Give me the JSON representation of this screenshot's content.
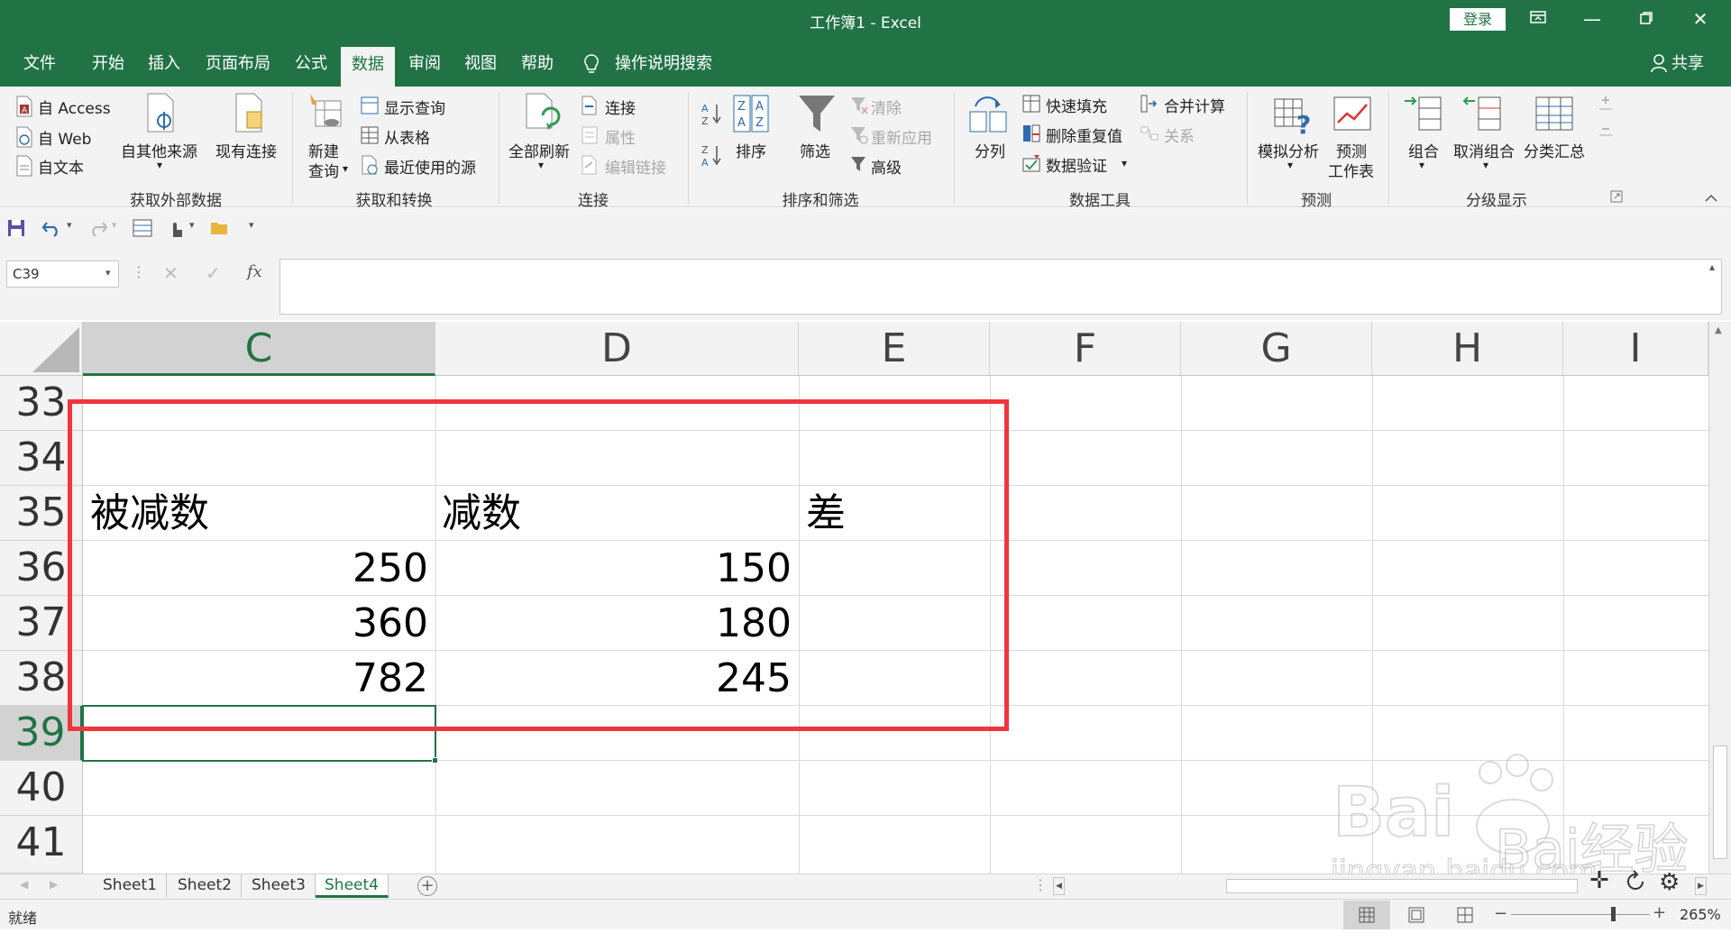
{
  "window": {
    "title": "工作簿1  -  Excel",
    "login": "登录"
  },
  "tabs": [
    "文件",
    "开始",
    "插入",
    "页面布局",
    "公式",
    "数据",
    "审阅",
    "视图",
    "帮助"
  ],
  "active_tab": "数据",
  "tell_me": "操作说明搜索",
  "share": "共享",
  "ribbon": {
    "get_external": {
      "access": "自 Access",
      "web": "自 Web",
      "text": "自文本",
      "other": "自其他来源",
      "existing": "现有连接",
      "label": "获取外部数据"
    },
    "get_transform": {
      "new_query": "新建\n查询",
      "new_query_line1": "新建",
      "new_query_line2": "查询",
      "show_queries": "显示查询",
      "from_table": "从表格",
      "recent_sources": "最近使用的源",
      "label": "获取和转换"
    },
    "connections": {
      "refresh_all": "全部刷新",
      "connections": "连接",
      "properties": "属性",
      "edit_links": "编辑链接",
      "label": "连接"
    },
    "sort_filter": {
      "sort": "排序",
      "filter": "筛选",
      "clear": "清除",
      "reapply": "重新应用",
      "advanced": "高级",
      "label": "排序和筛选"
    },
    "data_tools": {
      "split": "分列",
      "flash_fill": "快速填充",
      "remove_dup": "删除重复值",
      "validation": "数据验证",
      "consolidate": "合并计算",
      "relations": "关系",
      "label": "数据工具"
    },
    "forecast": {
      "what_if": "模拟分析",
      "forecast_sheet_1": "预测",
      "forecast_sheet_2": "工作表",
      "label": "预测"
    },
    "outline": {
      "group": "组合",
      "ungroup": "取消组合",
      "subtotal": "分类汇总",
      "label": "分级显示"
    }
  },
  "name_box": "C39",
  "fx": "fx",
  "columns": [
    "C",
    "D",
    "E",
    "F",
    "G",
    "H",
    "I"
  ],
  "selected_column": "C",
  "rows": [
    "33",
    "34",
    "35",
    "36",
    "37",
    "38",
    "39",
    "40",
    "41"
  ],
  "selected_row": "39",
  "cells": {
    "c35": "被减数",
    "d35": "减数",
    "e35": "差",
    "c36": "250",
    "d36": "150",
    "c37": "360",
    "d37": "180",
    "c38": "782",
    "d38": "245"
  },
  "sheets": [
    "Sheet1",
    "Sheet2",
    "Sheet3",
    "Sheet4"
  ],
  "active_sheet": "Sheet4",
  "status": {
    "ready": "就绪",
    "zoom": "265%"
  },
  "watermark": {
    "brand": "Bai经验",
    "url": "jingyan.baidu.com"
  },
  "colors": {
    "excel_green": "#217346",
    "highlight_box": "#f0353d"
  }
}
